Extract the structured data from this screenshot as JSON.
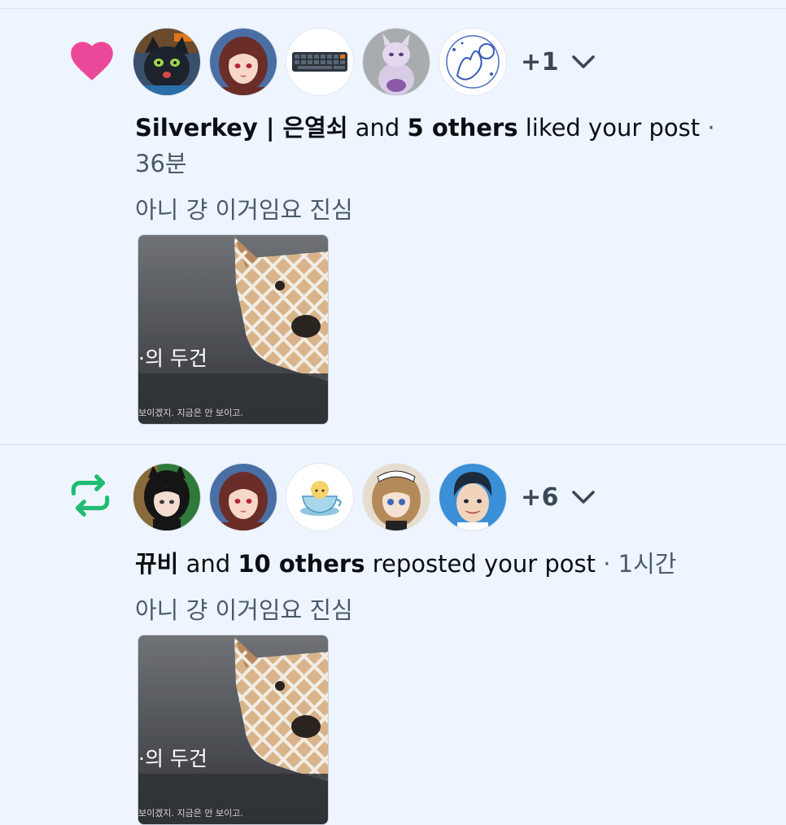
{
  "notifications": [
    {
      "type": "like",
      "icon": "heart-icon",
      "icon_color": "#ec4899",
      "more_count": "+1",
      "actor": "Silverkey | 은열쇠",
      "connector": " and ",
      "others": "5 others",
      "action": " liked your post",
      "separator": " · ",
      "time": "36분",
      "post_text": "아니 걍 이거임요 진심",
      "thumb_title": "·의 두건",
      "thumb_caption": "보이겠지. 지금은 안 보이고."
    },
    {
      "type": "repost",
      "icon": "repost-icon",
      "icon_color": "#20bc74",
      "more_count": "+6",
      "actor": "뀨비",
      "connector": " and ",
      "others": "10 others",
      "action": " reposted your post",
      "separator": " · ",
      "time": "1시간",
      "post_text": "아니 걍 이거임요 진심",
      "thumb_title": "·의 두건",
      "thumb_caption": "보이겠지. 지금은 안 보이고."
    }
  ]
}
